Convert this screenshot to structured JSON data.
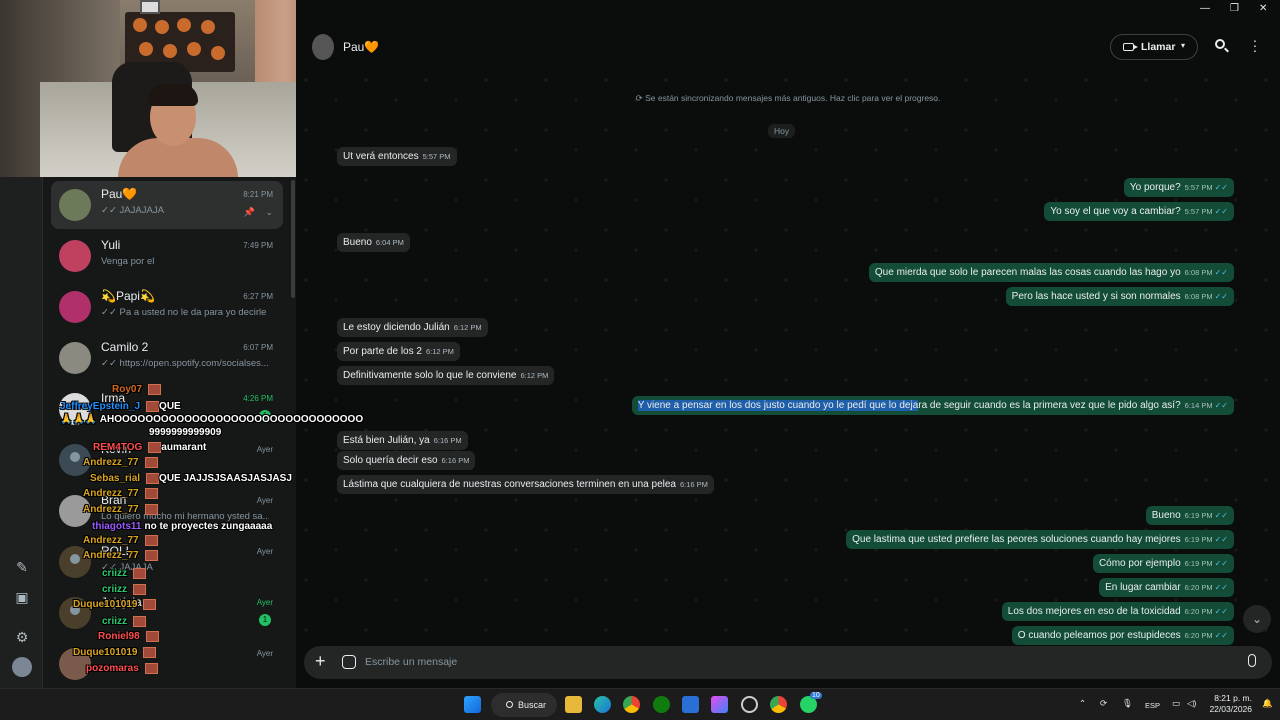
{
  "contact": {
    "name": "Pau🧡"
  },
  "header": {
    "call_label": "Llamar"
  },
  "sync_notice": "⟳ Se están sincronizando mensajes más antiguos. Haz clic para ver el progreso.",
  "day_label": "Hoy",
  "composer": {
    "placeholder": "Escribe un mensaje"
  },
  "chats": [
    {
      "name": "Pau🧡",
      "time": "8:21 PM",
      "preview": "✓✓ JAJAJAJA"
    },
    {
      "name": "Yuli",
      "time": "7:49 PM",
      "preview": "Venga por el"
    },
    {
      "name": "💫Papi💫",
      "time": "6:27 PM",
      "preview": "✓✓ Pa a usted no le da para yo decirle ..."
    },
    {
      "name": "Camilo 2",
      "time": "6:07 PM",
      "preview": "✓✓ https://open.spotify.com/socialses..."
    },
    {
      "name": "Irma",
      "time": "4:26 PM",
      "preview": ""
    },
    {
      "name": "Kevin",
      "time": "Ayer",
      "preview": ""
    },
    {
      "name": "Bran",
      "time": "Ayer",
      "preview": "Lo quiero mucho mi hermano ysted sa..."
    },
    {
      "name": "ROLI",
      "time": "Ayer",
      "preview": "✓✓ JAJAJA"
    },
    {
      "name": "Jajajaja",
      "time": "Ayer",
      "preview": ""
    },
    {
      "name": "",
      "time": "Ayer",
      "preview": ""
    }
  ],
  "unread": {
    "irma": "1",
    "jajajaja": "1"
  },
  "twitch": [
    {
      "user": "Roy07",
      "msg": "",
      "color": "#d2691e"
    },
    {
      "user": "JeffreyEpstein_J",
      "msg": "QUE",
      "color": "#1e90ff"
    },
    {
      "user": "",
      "msg": "🙏🙏🙏 AHOOOOOOOOOOOOOOOOOOOOOOOOOOOOOOOO",
      "color": "#ffffff"
    },
    {
      "user": "",
      "msg": "9999999999909",
      "color": "#ffffff"
    },
    {
      "user": "REM4TOG",
      "msg": "aumarant",
      "color": "#ff4d4d"
    },
    {
      "user": "Andrezz_77",
      "msg": "",
      "color": "#daa520"
    },
    {
      "user": "Sebas_rial",
      "msg": "QUE JAJJSJSAASJASJASJ",
      "color": "#daa520"
    },
    {
      "user": "Andrezz_77",
      "msg": "",
      "color": "#daa520"
    },
    {
      "user": "Andrezz_77",
      "msg": "",
      "color": "#daa520"
    },
    {
      "user": "thiagots11",
      "msg": "no te proyectes zungaaaaa",
      "color": "#9b59ff"
    },
    {
      "user": "Andrezz_77",
      "msg": "",
      "color": "#daa520"
    },
    {
      "user": "Andrezz_77",
      "msg": "",
      "color": "#daa520"
    },
    {
      "user": "criizz",
      "msg": "",
      "color": "#2ecc71"
    },
    {
      "user": "criizz",
      "msg": "",
      "color": "#2ecc71"
    },
    {
      "user": "Duque101019",
      "msg": "",
      "color": "#daa520"
    },
    {
      "user": "criizz",
      "msg": "",
      "color": "#2ecc71"
    },
    {
      "user": "Roniel98",
      "msg": "",
      "color": "#ff4d4d"
    },
    {
      "user": "Duque101019",
      "msg": "",
      "color": "#daa520"
    },
    {
      "user": "pozomaras",
      "msg": "",
      "color": "#ff4d4d"
    }
  ],
  "messages": [
    {
      "dir": "in",
      "text": "Ut verá entonces",
      "time": "5:57 PM"
    },
    {
      "dir": "out",
      "text": "Yo porque?",
      "time": "5:57 PM"
    },
    {
      "dir": "out",
      "text": "Yo soy el que voy a cambiar?",
      "time": "5:57 PM"
    },
    {
      "dir": "in",
      "text": "Bueno",
      "time": "6:04 PM"
    },
    {
      "dir": "out",
      "text": "Que mierda que solo le parecen malas las cosas cuando las hago yo",
      "time": "6:08 PM"
    },
    {
      "dir": "out",
      "text": "Pero las hace usted y si son normales",
      "time": "6:08 PM"
    },
    {
      "dir": "in",
      "text": "Le estoy diciendo Julián",
      "time": "6:12 PM"
    },
    {
      "dir": "in",
      "text": "Por parte de los 2",
      "time": "6:12 PM"
    },
    {
      "dir": "in",
      "text": "Definitivamente solo lo que le conviene",
      "time": "6:12 PM"
    },
    {
      "dir": "out",
      "text_highlight": "Y viene a pensar en los dos justo cuando yo le pedí que lo deja",
      "text_rest": "ra de seguir cuando es la primera vez que le pido algo así?",
      "time": "6:14 PM"
    },
    {
      "dir": "in",
      "text": "Está bien Julián, ya",
      "time": "6:16 PM"
    },
    {
      "dir": "in",
      "text": "Solo quería decir eso",
      "time": "6:16 PM"
    },
    {
      "dir": "in",
      "text": "Lástima que cualquiera de nuestras conversaciones terminen en una pelea",
      "time": "6:16 PM"
    },
    {
      "dir": "out",
      "text": "Bueno",
      "time": "6:19 PM"
    },
    {
      "dir": "out",
      "text": "Que lastima que usted prefiere las peores soluciones cuando hay mejores",
      "time": "6:19 PM"
    },
    {
      "dir": "out",
      "text": "Cómo por ejemplo",
      "time": "6:19 PM"
    },
    {
      "dir": "out",
      "text": "En lugar cambiar",
      "time": "6:20 PM"
    },
    {
      "dir": "out",
      "text": "Los dos mejores en eso de la toxicidad",
      "time": "6:20 PM"
    },
    {
      "dir": "out",
      "text": "O cuando peleamos por estupideces",
      "time": "6:20 PM"
    }
  ],
  "taskbar": {
    "search_label": "Buscar",
    "lang": "ESP",
    "time": "8:21 p. m.",
    "date": "22/03/2026",
    "whatsapp_badge": "10"
  }
}
